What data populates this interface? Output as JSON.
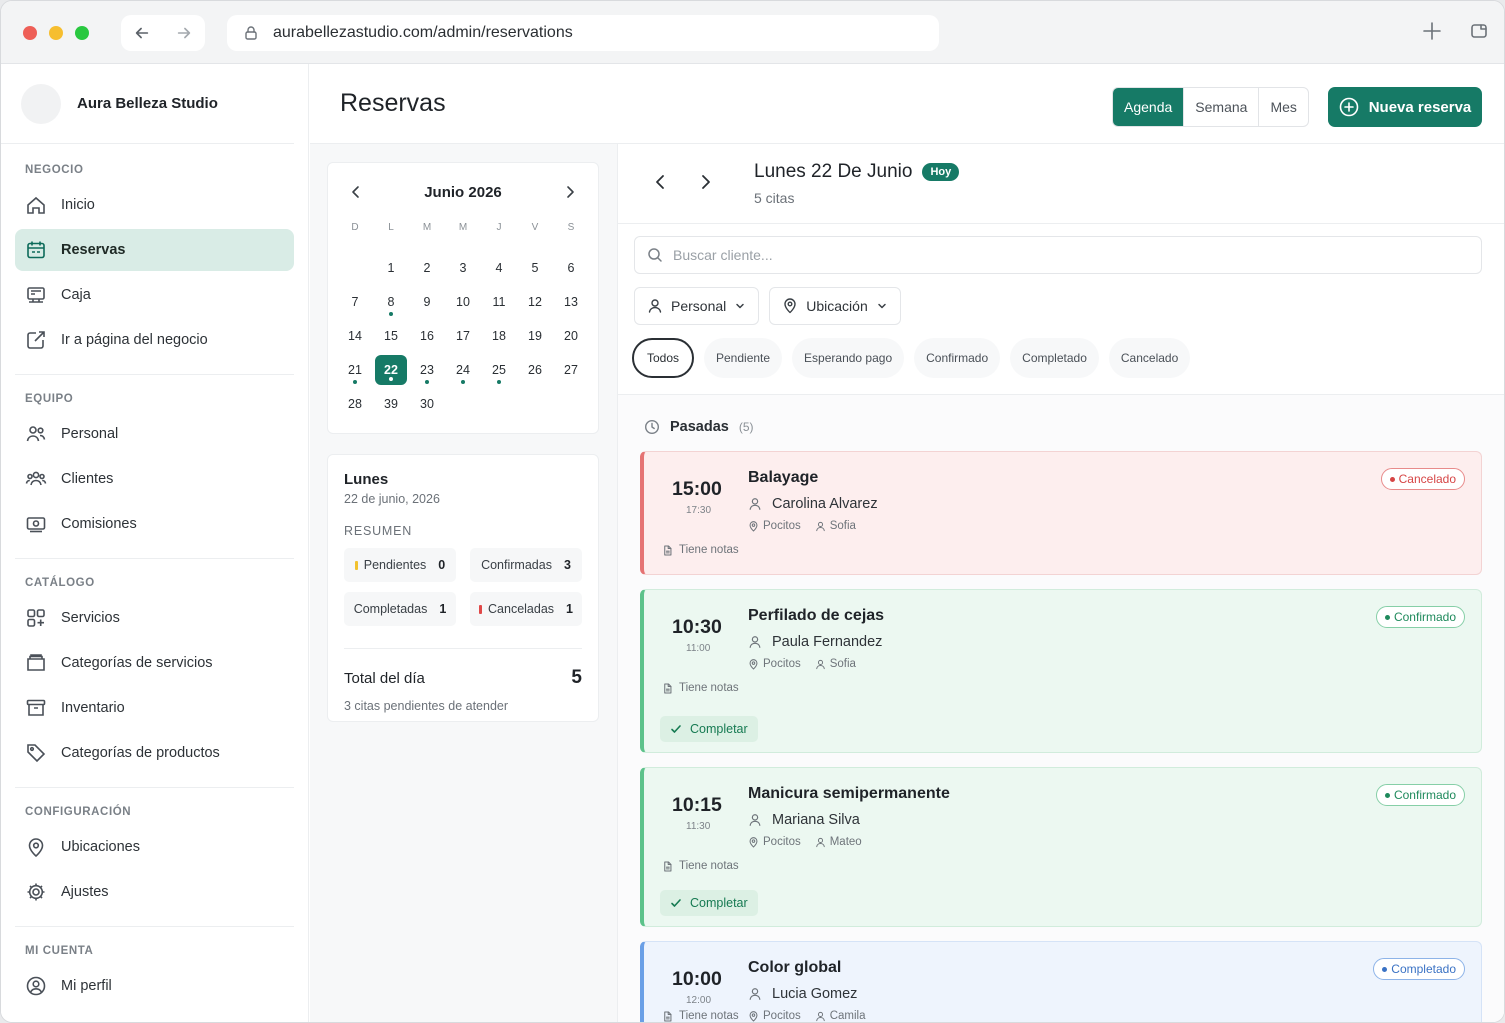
{
  "browser": {
    "url": "aurabellezastudio.com/admin/reservations",
    "traffic_colors": [
      "#ee5f57",
      "#f6be2f",
      "#29c840"
    ]
  },
  "sidebar": {
    "brand": "Aura Belleza Studio",
    "sections": [
      {
        "heading": "NEGOCIO",
        "items": [
          {
            "label": "Inicio",
            "icon": "home-icon"
          },
          {
            "label": "Reservas",
            "icon": "calendar-icon",
            "active": true
          },
          {
            "label": "Caja",
            "icon": "cash-register-icon"
          },
          {
            "label": "Ir a página del negocio",
            "icon": "external-link-icon"
          }
        ]
      },
      {
        "heading": "EQUIPO",
        "items": [
          {
            "label": "Personal",
            "icon": "users-icon"
          },
          {
            "label": "Clientes",
            "icon": "group-icon"
          },
          {
            "label": "Comisiones",
            "icon": "money-icon"
          }
        ]
      },
      {
        "heading": "CATÁLOGO",
        "items": [
          {
            "label": "Servicios",
            "icon": "grid-plus-icon"
          },
          {
            "label": "Categorías de servicios",
            "icon": "folder-icon"
          },
          {
            "label": "Inventario",
            "icon": "archive-icon"
          },
          {
            "label": "Categorías de productos",
            "icon": "tag-icon"
          }
        ]
      },
      {
        "heading": "CONFIGURACIÓN",
        "items": [
          {
            "label": "Ubicaciones",
            "icon": "location-pin-icon"
          },
          {
            "label": "Ajustes",
            "icon": "gear-icon"
          }
        ]
      },
      {
        "heading": "MI CUENTA",
        "items": [
          {
            "label": "Mi perfil",
            "icon": "user-circle-icon"
          }
        ]
      }
    ]
  },
  "header": {
    "title": "Reservas",
    "views": [
      "Agenda",
      "Semana",
      "Mes"
    ],
    "active_view": "Agenda",
    "new_button": "Nueva reserva"
  },
  "calendar": {
    "month": "Junio 2026",
    "weekdays": [
      "D",
      "L",
      "M",
      "M",
      "J",
      "V",
      "S"
    ],
    "leading_blanks": 1,
    "days": [
      "1",
      "2",
      "3",
      "4",
      "5",
      "6",
      "7",
      "8",
      "9",
      "10",
      "11",
      "12",
      "13",
      "14",
      "15",
      "16",
      "17",
      "18",
      "19",
      "20",
      "21",
      "22",
      "23",
      "24",
      "25",
      "26",
      "27",
      "28",
      "39",
      "30"
    ],
    "dots": [
      "8",
      "21",
      "22",
      "23",
      "24",
      "25"
    ],
    "selected": "22"
  },
  "summary": {
    "day": "Lunes",
    "date": "22 de junio, 2026",
    "label": "RESUMEN",
    "stats": [
      {
        "label": "Pendientes",
        "value": "0",
        "color": "#f2c230"
      },
      {
        "label": "Confirmadas",
        "value": "3",
        "color": ""
      },
      {
        "label": "Completadas",
        "value": "1",
        "color": ""
      },
      {
        "label": "Canceladas",
        "value": "1",
        "color": "#e04848"
      }
    ],
    "total_label": "Total del día",
    "total_value": "5",
    "total_sub": "3 citas pendientes de atender"
  },
  "day_view": {
    "title": "Lunes 22 De Junio",
    "today_badge": "Hoy",
    "subtitle": "5 citas",
    "search_placeholder": "Buscar cliente...",
    "filters": [
      "Personal",
      "Ubicación"
    ],
    "status_tabs": [
      "Todos",
      "Pendiente",
      "Esperando pago",
      "Confirmado",
      "Completado",
      "Cancelado"
    ],
    "active_tab": "Todos",
    "group_label": "Pasadas",
    "group_count": "(5)",
    "notes_label": "Tiene notas",
    "complete_label": "Completar"
  },
  "appointments": [
    {
      "time": "15:00",
      "end": "17:30",
      "service": "Balayage",
      "client": "Carolina Alvarez",
      "location": "Pocitos",
      "staff": "Sofia",
      "status": "Cancelado",
      "tone": "red",
      "has_complete": false
    },
    {
      "time": "10:30",
      "end": "11:00",
      "service": "Perfilado de cejas",
      "client": "Paula Fernandez",
      "location": "Pocitos",
      "staff": "Sofia",
      "status": "Confirmado",
      "tone": "green",
      "has_complete": true
    },
    {
      "time": "10:15",
      "end": "11:30",
      "service": "Manicura semipermanente",
      "client": "Mariana Silva",
      "location": "Pocitos",
      "staff": "Mateo",
      "status": "Confirmado",
      "tone": "green",
      "has_complete": true
    },
    {
      "time": "10:00",
      "end": "12:00",
      "service": "Color global",
      "client": "Lucia Gomez",
      "location": "Pocitos",
      "staff": "Camila",
      "status": "Completado",
      "tone": "blue",
      "has_complete": false
    }
  ]
}
